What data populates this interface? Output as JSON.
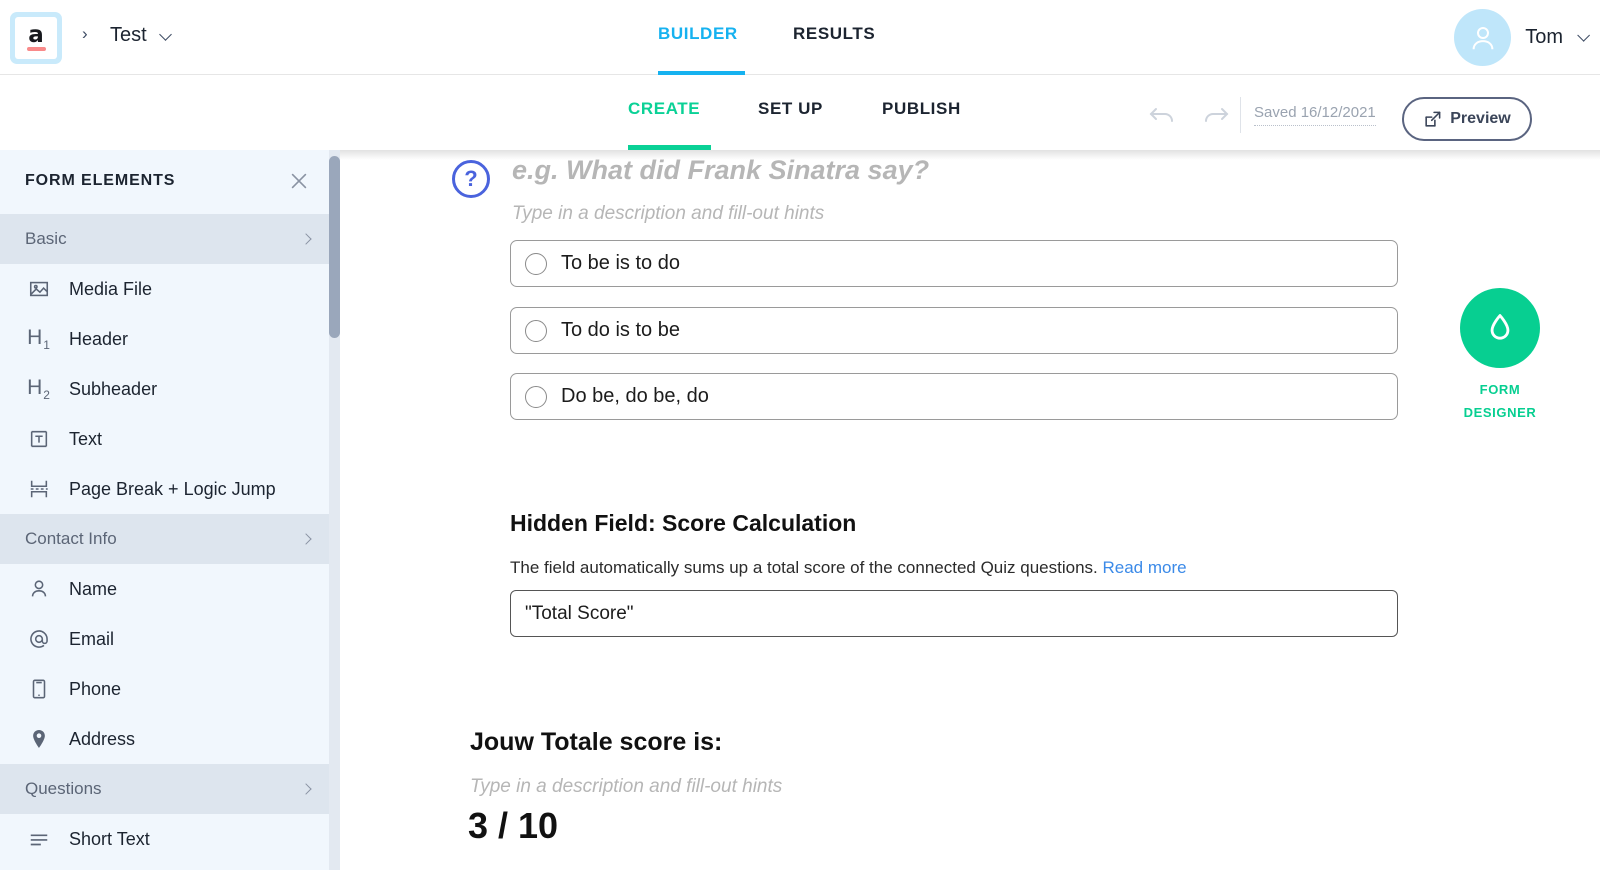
{
  "app": {
    "logo_letter": "a",
    "breadcrumb_separator": "›",
    "breadcrumb_name": "Test"
  },
  "header": {
    "main_tabs": [
      {
        "label": "BUILDER",
        "active": true
      },
      {
        "label": "RESULTS",
        "active": false
      }
    ],
    "user": {
      "name": "Tom"
    },
    "accent_blue": "#16b2f0"
  },
  "subheader": {
    "tabs": [
      {
        "label": "CREATE",
        "active": true
      },
      {
        "label": "SET UP",
        "active": false
      },
      {
        "label": "PUBLISH",
        "active": false
      }
    ],
    "undo_label": "undo",
    "redo_label": "redo",
    "saved_text": "Saved 16/12/2021",
    "preview_label": "Preview",
    "accent_green": "#0ad196"
  },
  "sidebar": {
    "title": "FORM ELEMENTS",
    "close_label": "close",
    "groups": [
      {
        "label": "Basic",
        "items": [
          {
            "icon": "media-file-icon",
            "label": "Media File"
          },
          {
            "icon": "header-h1-icon",
            "label": "Header"
          },
          {
            "icon": "subheader-h2-icon",
            "label": "Subheader"
          },
          {
            "icon": "text-icon",
            "label": "Text"
          },
          {
            "icon": "page-break-icon",
            "label": "Page Break + Logic Jump"
          }
        ]
      },
      {
        "label": "Contact Info",
        "items": [
          {
            "icon": "person-icon",
            "label": "Name"
          },
          {
            "icon": "at-sign-icon",
            "label": "Email"
          },
          {
            "icon": "phone-icon",
            "label": "Phone"
          },
          {
            "icon": "map-pin-icon",
            "label": "Address"
          }
        ]
      },
      {
        "label": "Questions",
        "items": [
          {
            "icon": "short-text-icon",
            "label": "Short Text"
          }
        ]
      }
    ]
  },
  "main": {
    "question": {
      "icon": "question-mark-icon",
      "title_placeholder": "e.g. What did Frank Sinatra say?",
      "description_placeholder": "Type in a description and fill-out hints",
      "options": [
        {
          "label": "To be is to do",
          "selected": false
        },
        {
          "label": "To do is to be",
          "selected": false
        },
        {
          "label": "Do be, do be, do",
          "selected": false
        }
      ]
    },
    "hidden_field": {
      "title": "Hidden Field: Score Calculation",
      "description": "The field automatically sums up a total score of the connected Quiz questions.",
      "link_label": "Read more",
      "value": "\"Total Score\""
    },
    "score_block": {
      "title": "Jouw Totale score is:",
      "description_placeholder": "Type in a description and fill-out hints",
      "value": "3 / 10"
    }
  },
  "form_designer": {
    "icon": "water-drop-icon",
    "line1": "FORM",
    "line2": "DESIGNER",
    "color": "#07cf91"
  }
}
